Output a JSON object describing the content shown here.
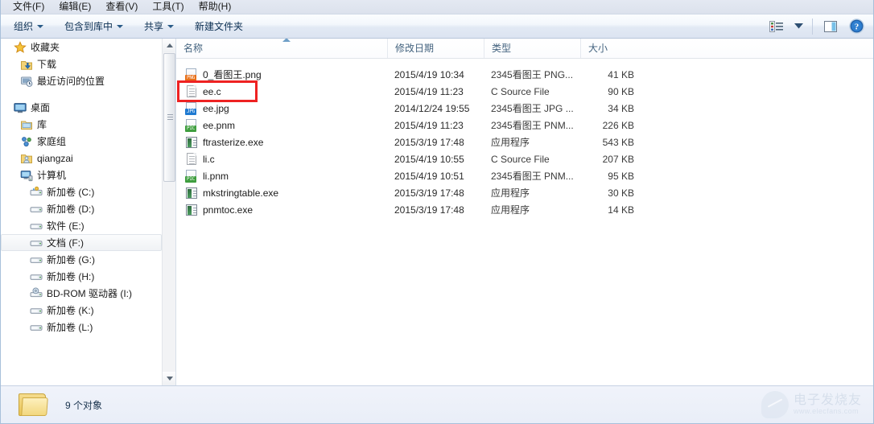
{
  "menubar": {
    "items": [
      {
        "label": "文件(F)",
        "name": "menu-file"
      },
      {
        "label": "编辑(E)",
        "name": "menu-edit"
      },
      {
        "label": "查看(V)",
        "name": "menu-view"
      },
      {
        "label": "工具(T)",
        "name": "menu-tools"
      },
      {
        "label": "帮助(H)",
        "name": "menu-help"
      }
    ]
  },
  "toolbar": {
    "organize_label": "组织",
    "include_library_label": "包含到库中",
    "share_label": "共享",
    "new_folder_label": "新建文件夹",
    "view_icon": "list-view-icon",
    "view_caret_icon": "chevron-down-icon",
    "preview_pane_icon": "preview-pane-icon",
    "help_icon": "help-icon"
  },
  "sidebar": {
    "items": [
      {
        "label": "收藏夹",
        "icon": "star-icon",
        "level": 0,
        "selected": false,
        "name": "sidebar-item-favorites"
      },
      {
        "label": "下载",
        "icon": "download-folder-icon",
        "level": 1,
        "selected": false,
        "name": "sidebar-item-downloads"
      },
      {
        "label": "最近访问的位置",
        "icon": "recent-places-icon",
        "level": 1,
        "selected": false,
        "name": "sidebar-item-recent-places"
      },
      {
        "label": "桌面",
        "icon": "desktop-icon",
        "level": 0,
        "selected": false,
        "name": "sidebar-item-desktop",
        "gapBefore": true
      },
      {
        "label": "库",
        "icon": "library-icon",
        "level": 1,
        "selected": false,
        "name": "sidebar-item-libraries"
      },
      {
        "label": "家庭组",
        "icon": "homegroup-icon",
        "level": 1,
        "selected": false,
        "name": "sidebar-item-homegroup"
      },
      {
        "label": "qiangzai",
        "icon": "user-folder-icon",
        "level": 1,
        "selected": false,
        "name": "sidebar-item-user"
      },
      {
        "label": "计算机",
        "icon": "computer-icon",
        "level": 1,
        "selected": false,
        "name": "sidebar-item-computer"
      },
      {
        "label": "新加卷 (C:)",
        "icon": "system-drive-icon",
        "level": 2,
        "selected": false,
        "name": "sidebar-item-drive-c"
      },
      {
        "label": "新加卷 (D:)",
        "icon": "drive-icon",
        "level": 2,
        "selected": false,
        "name": "sidebar-item-drive-d"
      },
      {
        "label": "软件 (E:)",
        "icon": "drive-icon",
        "level": 2,
        "selected": false,
        "name": "sidebar-item-drive-e"
      },
      {
        "label": "文档 (F:)",
        "icon": "drive-icon",
        "level": 2,
        "selected": true,
        "name": "sidebar-item-drive-f"
      },
      {
        "label": "新加卷 (G:)",
        "icon": "drive-icon",
        "level": 2,
        "selected": false,
        "name": "sidebar-item-drive-g"
      },
      {
        "label": "新加卷 (H:)",
        "icon": "drive-icon",
        "level": 2,
        "selected": false,
        "name": "sidebar-item-drive-h"
      },
      {
        "label": "BD-ROM 驱动器 (I:)",
        "icon": "optical-drive-icon",
        "level": 2,
        "selected": false,
        "name": "sidebar-item-drive-i"
      },
      {
        "label": "新加卷 (K:)",
        "icon": "drive-icon",
        "level": 2,
        "selected": false,
        "name": "sidebar-item-drive-k"
      },
      {
        "label": "新加卷 (L:)",
        "icon": "drive-icon",
        "level": 2,
        "selected": false,
        "name": "sidebar-item-drive-l"
      }
    ]
  },
  "filelist": {
    "columns": [
      {
        "label": "名称",
        "name": "column-header-name"
      },
      {
        "label": "修改日期",
        "name": "column-header-date"
      },
      {
        "label": "类型",
        "name": "column-header-type"
      },
      {
        "label": "大小",
        "name": "column-header-size"
      }
    ],
    "sort_indicator": "sort-ascending-icon",
    "rows": [
      {
        "name": "0_看图王.png",
        "date": "2015/4/19 10:34",
        "type": "2345看图王 PNG...",
        "size": "41 KB",
        "icon": "png-file-icon",
        "badge": "PNG",
        "badge_color": "#e8701a"
      },
      {
        "name": "ee.c",
        "date": "2015/4/19 11:23",
        "type": "C Source File",
        "size": "90 KB",
        "icon": "c-source-file-icon",
        "badge": "",
        "badge_color": ""
      },
      {
        "name": "ee.jpg",
        "date": "2014/12/24 19:55",
        "type": "2345看图王 JPG ...",
        "size": "34 KB",
        "icon": "jpg-file-icon",
        "badge": "JPG",
        "badge_color": "#1f7ad1"
      },
      {
        "name": "ee.pnm",
        "date": "2015/4/19 11:23",
        "type": "2345看图王 PNM...",
        "size": "226 KB",
        "icon": "pnm-file-icon",
        "badge": "PIC",
        "badge_color": "#3f9e3f"
      },
      {
        "name": "ftrasterize.exe",
        "date": "2015/3/19 17:48",
        "type": "应用程序",
        "size": "543 KB",
        "icon": "application-icon",
        "badge": "",
        "badge_color": ""
      },
      {
        "name": "li.c",
        "date": "2015/4/19 10:55",
        "type": "C Source File",
        "size": "207 KB",
        "icon": "c-source-file-icon",
        "badge": "",
        "badge_color": ""
      },
      {
        "name": "li.pnm",
        "date": "2015/4/19 10:51",
        "type": "2345看图王 PNM...",
        "size": "95 KB",
        "icon": "pnm-file-icon",
        "badge": "PIC",
        "badge_color": "#3f9e3f"
      },
      {
        "name": "mkstringtable.exe",
        "date": "2015/3/19 17:48",
        "type": "应用程序",
        "size": "30 KB",
        "icon": "application-icon",
        "badge": "",
        "badge_color": ""
      },
      {
        "name": "pnmtoc.exe",
        "date": "2015/3/19 17:48",
        "type": "应用程序",
        "size": "14 KB",
        "icon": "application-icon",
        "badge": "",
        "badge_color": ""
      }
    ],
    "highlight": {
      "row_index": 1,
      "color": "#ee2222"
    }
  },
  "statusbar": {
    "text": "9 个对象",
    "folder_icon": "folder-icon"
  },
  "watermark": {
    "name": "电子发烧友",
    "url": "www.elecfans.com"
  }
}
